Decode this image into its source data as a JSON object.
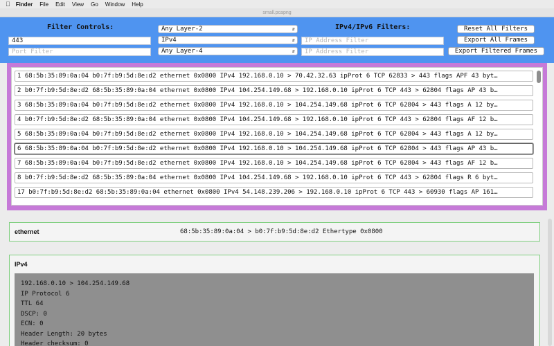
{
  "menubar": {
    "app_name": "Finder",
    "items": [
      "File",
      "Edit",
      "View",
      "Go",
      "Window",
      "Help"
    ]
  },
  "window": {
    "title": "small.pcapng"
  },
  "filters": {
    "title": "Filter Controls:",
    "port_value": "443",
    "port_placeholder": "Port Filter",
    "layer2_selected": "Any Layer-2",
    "layer3_selected": "IPv4",
    "layer4_selected": "Any Layer-4",
    "ip_title": "IPv4/IPv6 Filters:",
    "ip_placeholder_1": "IP Address Filter",
    "ip_placeholder_2": "IP Address Filter",
    "reset_label": "Reset All Filters",
    "export_all_label": "Export All Frames",
    "export_filtered_label": "Export Filtered Frames"
  },
  "frames": [
    "1 68:5b:35:89:0a:04 b0:7f:b9:5d:8e:d2 ethernet 0x0800 IPv4 192.168.0.10 > 70.42.32.63 ipProt 6 TCP 62833 > 443 flags APF 43 byt…",
    "2 b0:7f:b9:5d:8e:d2 68:5b:35:89:0a:04 ethernet 0x0800 IPv4 104.254.149.68 > 192.168.0.10 ipProt 6 TCP 443 > 62804 flags AP 43 b…",
    "3 68:5b:35:89:0a:04 b0:7f:b9:5d:8e:d2 ethernet 0x0800 IPv4 192.168.0.10 > 104.254.149.68 ipProt 6 TCP 62804 > 443 flags A 12 by…",
    "4 b0:7f:b9:5d:8e:d2 68:5b:35:89:0a:04 ethernet 0x0800 IPv4 104.254.149.68 > 192.168.0.10 ipProt 6 TCP 443 > 62804 flags AF 12 b…",
    "5 68:5b:35:89:0a:04 b0:7f:b9:5d:8e:d2 ethernet 0x0800 IPv4 192.168.0.10 > 104.254.149.68 ipProt 6 TCP 62804 > 443 flags A 12 by…",
    "6 68:5b:35:89:0a:04 b0:7f:b9:5d:8e:d2 ethernet 0x0800 IPv4 192.168.0.10 > 104.254.149.68 ipProt 6 TCP 62804 > 443 flags AP 43 b…",
    "7 68:5b:35:89:0a:04 b0:7f:b9:5d:8e:d2 ethernet 0x0800 IPv4 192.168.0.10 > 104.254.149.68 ipProt 6 TCP 62804 > 443 flags AF 12 b…",
    "8 b0:7f:b9:5d:8e:d2 68:5b:35:89:0a:04 ethernet 0x0800 IPv4 104.254.149.68 > 192.168.0.10 ipProt 6 TCP 443 > 62804 flags R 6 byt…",
    "17 b0:7f:b9:5d:8e:d2 68:5b:35:89:0a:04 ethernet 0x0800 IPv4 54.148.239.206 > 192.168.0.10 ipProt 6 TCP 443 > 60930 flags AP 161…"
  ],
  "selected_frame_index": 5,
  "detail": {
    "ethernet_label": "ethernet",
    "ethernet_info": "68:5b:35:89:0a:04 > b0:7f:b9:5d:8e:d2 Ethertype 0x0800",
    "ipv4_label": "IPv4",
    "ipv4_lines": [
      "192.168.0.10 > 104.254.149.68",
      "IP Protocol 6",
      "TTL 64",
      "DSCP: 0",
      "ECN: 0",
      "Header Length: 20 bytes",
      "Header checksum: 0"
    ]
  },
  "colors": {
    "filter_bar": "#4f94f0",
    "frame_list_bg": "#c67ad8",
    "detail_border": "#7fcf7f",
    "detail_fill": "#8f8f8f"
  },
  "icons": {
    "apple": "apple-logo-icon",
    "chevron": "updown-chevron-icon"
  }
}
